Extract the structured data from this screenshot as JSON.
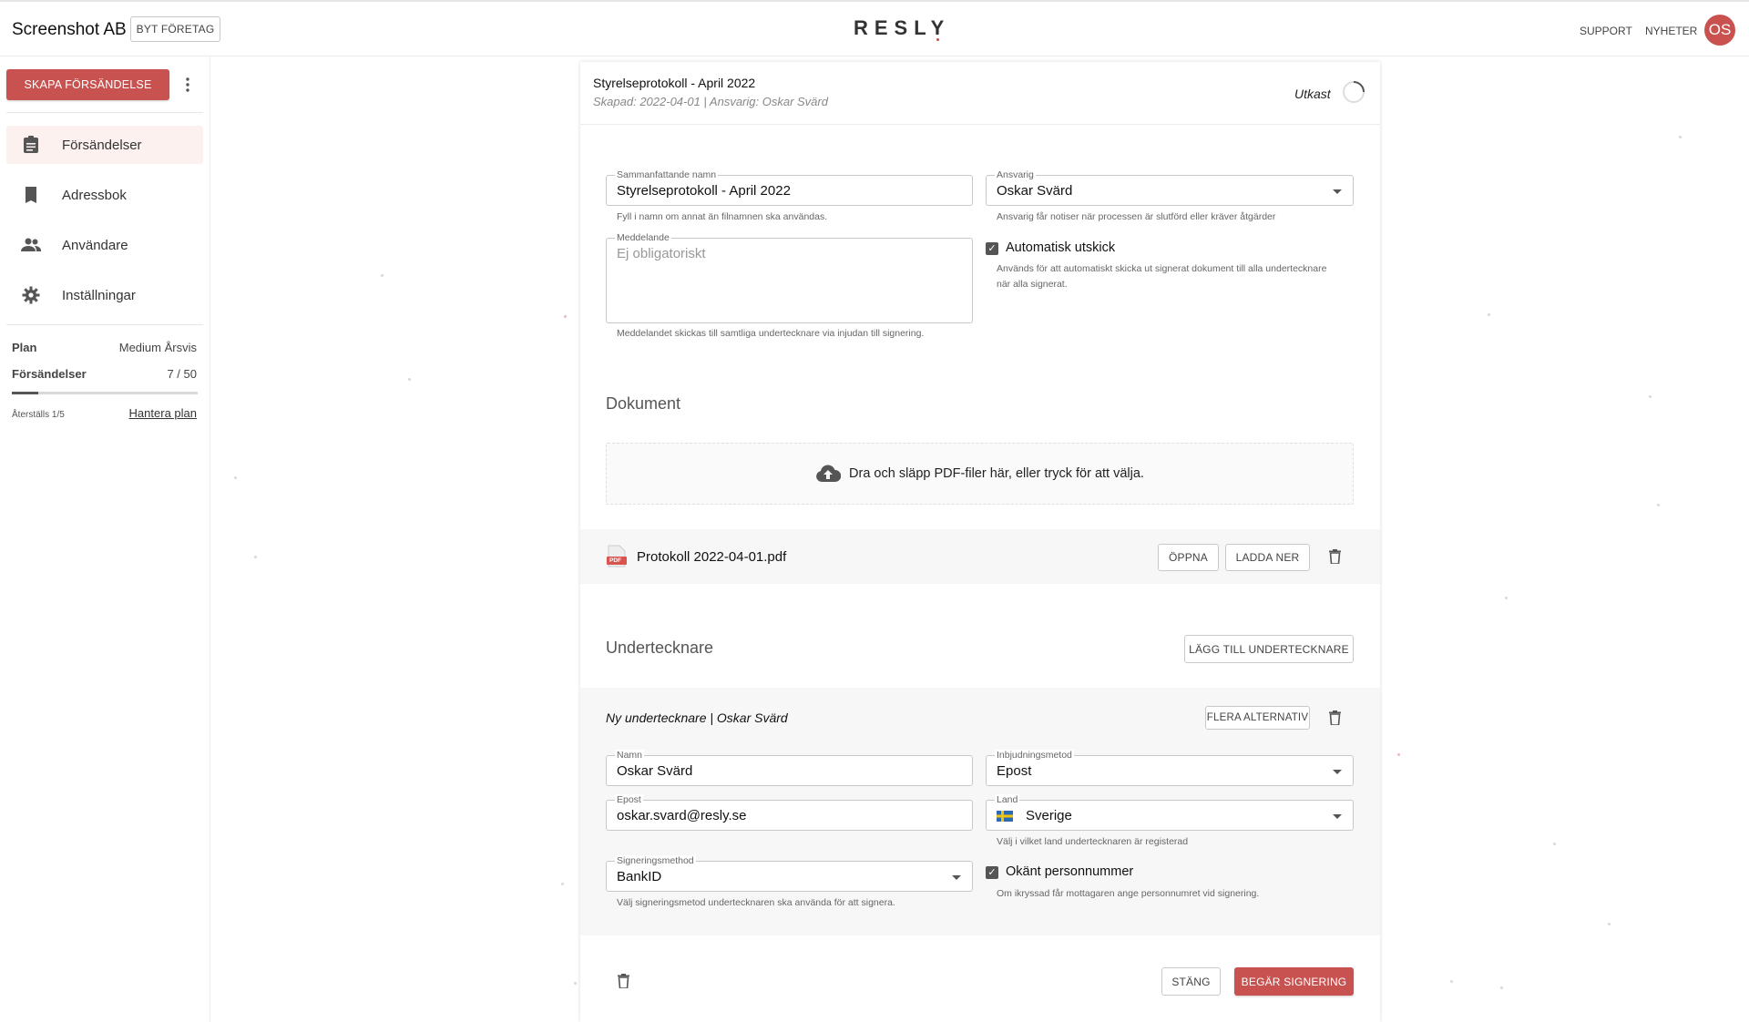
{
  "header": {
    "company": "Screenshot AB",
    "switch_company": "BYT FÖRETAG",
    "logo": "RESLY",
    "support": "SUPPORT",
    "news": "NYHETER",
    "avatar_initials": "OS"
  },
  "sidebar": {
    "create_button": "SKAPA FÖRSÄNDELSE",
    "items": [
      {
        "label": "Försändelser",
        "icon": "clipboard-icon",
        "active": true
      },
      {
        "label": "Adressbok",
        "icon": "book-icon",
        "active": false
      },
      {
        "label": "Användare",
        "icon": "users-icon",
        "active": false
      },
      {
        "label": "Inställningar",
        "icon": "gear-icon",
        "active": false
      }
    ],
    "plan_label": "Plan",
    "plan_value": "Medium Årsvis",
    "usage_label": "Försändelser",
    "usage_value": "7 / 50",
    "usage_fraction": 0.14,
    "reset_text": "Återställs 1/5",
    "manage_plan": "Hantera plan"
  },
  "document": {
    "title": "Styrelseprotokoll - April 2022",
    "meta": "Skapad: 2022-04-01 | Ansvarig: Oskar Svärd",
    "status": "Utkast",
    "summary_label": "Sammanfattande namn",
    "summary_value": "Styrelseprotokoll - April 2022",
    "summary_helper": "Fyll i namn om annat än filnamnen ska användas.",
    "responsible_label": "Ansvarig",
    "responsible_value": "Oskar Svärd",
    "responsible_helper": "Ansvarig får notiser när processen är slutförd eller kräver åtgärder",
    "message_label": "Meddelande",
    "message_placeholder": "Ej obligatoriskt",
    "message_helper": "Meddelandet skickas till samtliga undertecknare via injudan till signering.",
    "auto_send_label": "Automatisk utskick",
    "auto_send_checked": true,
    "auto_send_helper_1": "Används för att automatiskt skicka ut signerat dokument till alla undertecknare",
    "auto_send_helper_2": "när alla signerat."
  },
  "documents_section": {
    "title": "Dokument",
    "dropzone": "Dra och släpp PDF-filer här, eller tryck för att välja.",
    "file_name": "Protokoll 2022-04-01.pdf",
    "pdf_badge": "PDF",
    "open": "ÖPPNA",
    "download": "LADDA NER"
  },
  "signers_section": {
    "title": "Undertecknare",
    "add_signer": "LÄGG TILL UNDERTECKNARE",
    "signer_header": "Ny undertecknare | Oskar Svärd",
    "more_options": "FLERA ALTERNATIV",
    "name_label": "Namn",
    "name_value": "Oskar Svärd",
    "invite_label": "Inbjudningsmetod",
    "invite_value": "Epost",
    "email_label": "Epost",
    "email_value": "oskar.svard@resly.se",
    "country_label": "Land",
    "country_value": "Sverige",
    "country_helper": "Välj i vilket land undertecknaren är registerad",
    "sign_method_label": "Signeringsmethod",
    "sign_method_value": "BankID",
    "sign_method_helper": "Välj signeringsmetod undertecknaren ska använda för att signera.",
    "unknown_pn_label": "Okänt personnummer",
    "unknown_pn_checked": true,
    "unknown_pn_helper": "Om ikryssad får mottagaren ange personnumret vid signering."
  },
  "footer": {
    "close": "STÄNG",
    "request_signing": "BEGÄR SIGNERING"
  },
  "colors": {
    "accent": "#c7524f",
    "active_nav_bg": "#fdf1f0",
    "swedish_blue": "#2a6bb3",
    "swedish_yellow": "#f2c20f"
  }
}
